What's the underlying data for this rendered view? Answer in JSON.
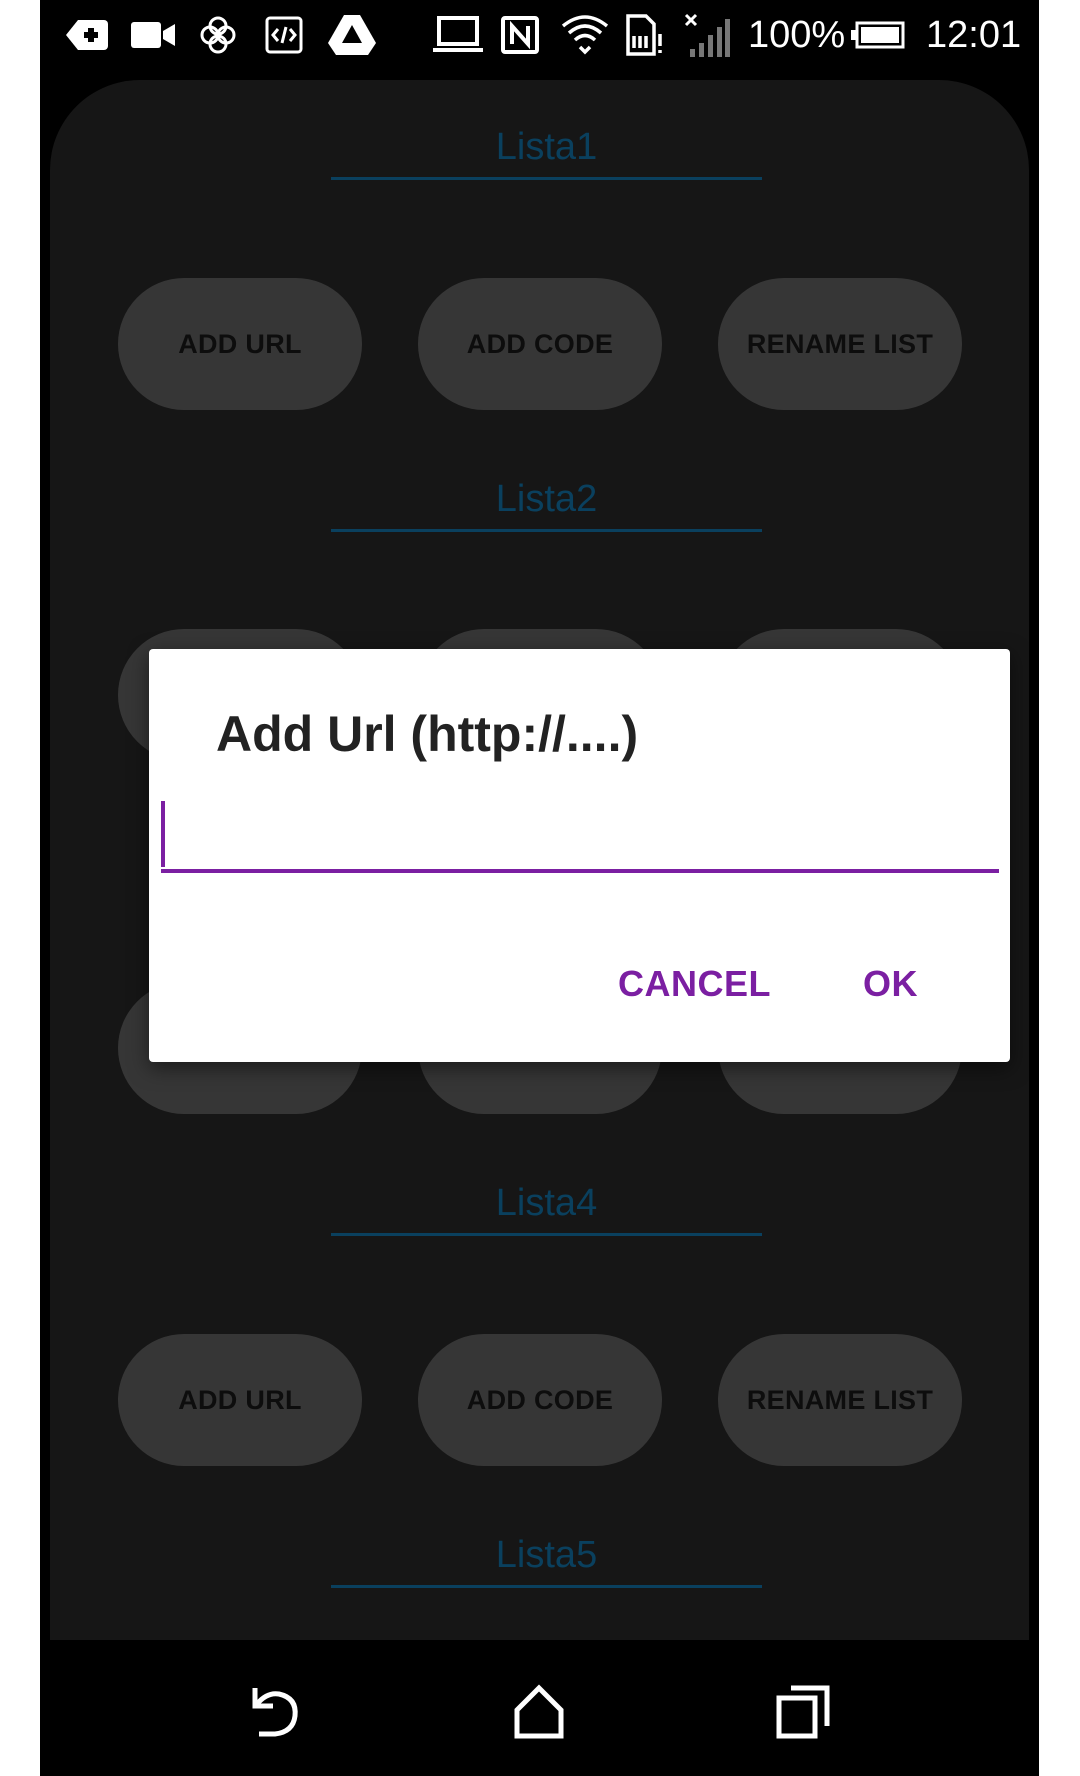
{
  "status_bar": {
    "battery_percent": "100%",
    "clock": "12:01",
    "icons": [
      "add-notification-icon",
      "video-camera-icon",
      "hexagon-pattern-icon",
      "code-box-icon",
      "drive-icon",
      "laptop-icon",
      "nfc-icon",
      "wifi-icon",
      "sim-card-alert-icon",
      "no-signal-icon",
      "battery-icon"
    ]
  },
  "lists": [
    {
      "title": "Lista1",
      "buttons": [
        "ADD URL",
        "ADD CODE",
        "RENAME LIST"
      ]
    },
    {
      "title": "Lista2",
      "buttons": [
        "",
        "",
        ""
      ]
    },
    {
      "title": "",
      "buttons": [
        "",
        "",
        ""
      ]
    },
    {
      "title": "Lista4",
      "buttons": [
        "ADD URL",
        "ADD CODE",
        "RENAME LIST"
      ]
    },
    {
      "title": "Lista5",
      "buttons": []
    }
  ],
  "dialog": {
    "title": "Add Url (http://....)",
    "input_value": "",
    "cancel_label": "CANCEL",
    "ok_label": "OK",
    "accent_color": "#7b1fa2"
  },
  "nav_bar": {
    "icons": [
      "back-icon",
      "home-icon",
      "recents-icon"
    ]
  }
}
